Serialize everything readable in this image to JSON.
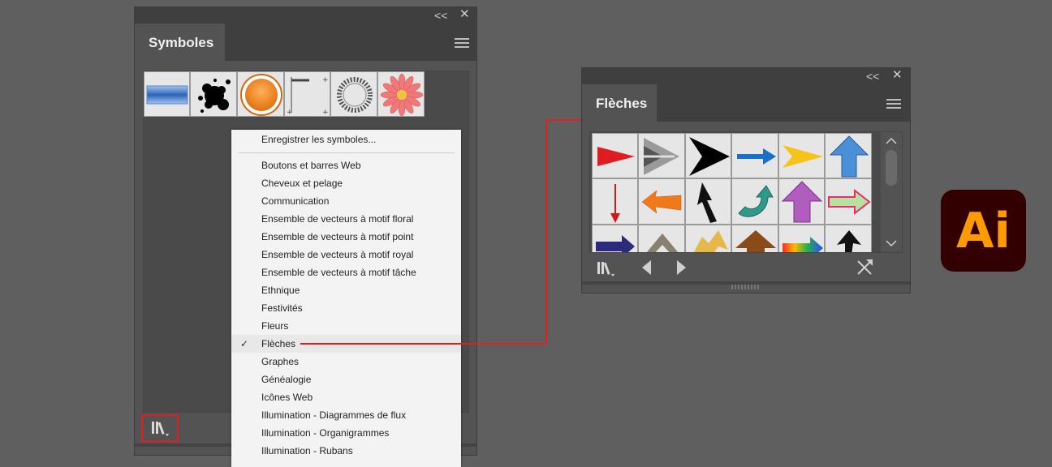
{
  "symbols_panel": {
    "title": "Symboles",
    "collapse_label": "<<",
    "close_label": "✕"
  },
  "library_menu": {
    "first_item": "Enregistrer les symboles...",
    "items": [
      "Boutons et barres Web",
      "Cheveux et pelage",
      "Communication",
      "Ensemble de vecteurs à motif floral",
      "Ensemble de vecteurs à motif point",
      "Ensemble de vecteurs à motif royal",
      "Ensemble de vecteurs à motif tâche",
      "Ethnique",
      "Festivités",
      "Fleurs",
      "Flèches",
      "Graphes",
      "Généalogie",
      "Icônes Web",
      "Illumination - Diagrammes de flux",
      "Illumination - Organigrammes",
      "Illumination - Rubans"
    ],
    "checked_item": "Flèches",
    "check_mark": "✓"
  },
  "arrows_panel": {
    "title": "Flèches",
    "collapse_label": "<<",
    "close_label": "✕"
  },
  "app_icon": {
    "label": "Ai",
    "bg_color": "#330000",
    "text_color": "#ff9a00"
  },
  "colors": {
    "highlight": "#e02020"
  }
}
